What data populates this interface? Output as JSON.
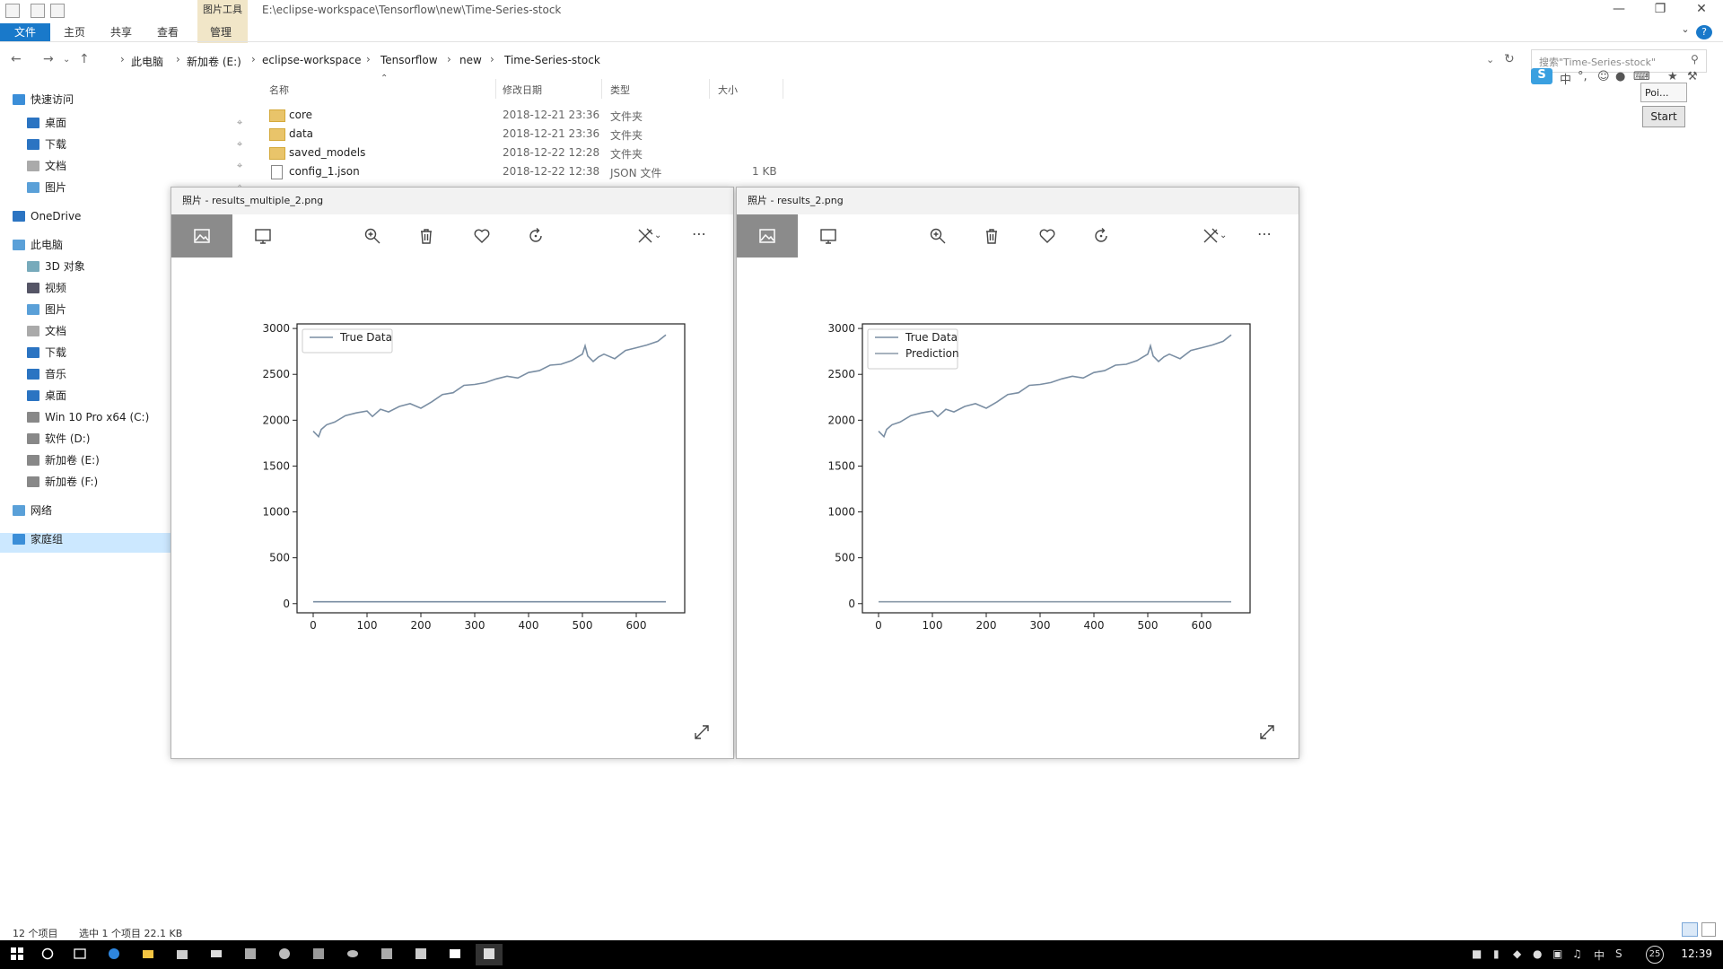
{
  "window": {
    "title_path": "E:\\eclipse-workspace\\Tensorflow\\new\\Time-Series-stock",
    "contextual_tab": "图片工具"
  },
  "ribbon": {
    "tabs": [
      "文件",
      "主页",
      "共享",
      "查看",
      "管理"
    ]
  },
  "address": {
    "crumbs": [
      "此电脑",
      "新加卷 (E:)",
      "eclipse-workspace",
      "Tensorflow",
      "new",
      "Time-Series-stock"
    ],
    "search_placeholder": "搜索\"Time-Series-stock\""
  },
  "ime": {
    "poi_label": "Poi...",
    "start_label": "Start"
  },
  "nav": {
    "items": [
      {
        "label": "快速访问",
        "icon": "star-icon"
      },
      {
        "label": "桌面",
        "icon": "desktop-icon",
        "pinned": true
      },
      {
        "label": "下载",
        "icon": "download-icon",
        "pinned": true
      },
      {
        "label": "文档",
        "icon": "document-icon",
        "pinned": true
      },
      {
        "label": "图片",
        "icon": "picture-icon",
        "pinned": true
      },
      {
        "label": "OneDrive",
        "icon": "cloud-icon"
      },
      {
        "label": "此电脑",
        "icon": "computer-icon"
      },
      {
        "label": "3D 对象",
        "icon": "cube-icon"
      },
      {
        "label": "视频",
        "icon": "video-icon"
      },
      {
        "label": "图片",
        "icon": "picture-icon"
      },
      {
        "label": "文档",
        "icon": "document-icon"
      },
      {
        "label": "下载",
        "icon": "download-icon"
      },
      {
        "label": "音乐",
        "icon": "music-icon"
      },
      {
        "label": "桌面",
        "icon": "desktop-icon"
      },
      {
        "label": "Win 10 Pro x64 (C:)",
        "icon": "drive-icon"
      },
      {
        "label": "软件 (D:)",
        "icon": "drive-icon"
      },
      {
        "label": "新加卷 (E:)",
        "icon": "drive-icon"
      },
      {
        "label": "新加卷 (F:)",
        "icon": "drive-icon"
      },
      {
        "label": "网络",
        "icon": "network-icon"
      },
      {
        "label": "家庭组",
        "icon": "homegroup-icon"
      }
    ]
  },
  "filelist": {
    "headers": [
      "名称",
      "修改日期",
      "类型",
      "大小"
    ],
    "rows": [
      {
        "name": "core",
        "date": "2018-12-21 23:36",
        "type": "文件夹",
        "size": ""
      },
      {
        "name": "data",
        "date": "2018-12-21 23:36",
        "type": "文件夹",
        "size": ""
      },
      {
        "name": "saved_models",
        "date": "2018-12-22 12:28",
        "type": "文件夹",
        "size": ""
      },
      {
        "name": "config_1.json",
        "date": "2018-12-22 12:38",
        "type": "JSON 文件",
        "size": "1 KB"
      }
    ]
  },
  "status": {
    "count": "12 个项目",
    "selection": "选中 1 个项目  22.1 KB"
  },
  "photo_left": {
    "title": "照片 - results_multiple_2.png"
  },
  "photo_right": {
    "title": "照片 - results_2.png"
  },
  "chart_data": [
    {
      "type": "line",
      "xlim": [
        -30,
        690
      ],
      "ylim": [
        -100,
        3050
      ],
      "xticks": [
        0,
        100,
        200,
        300,
        400,
        500,
        600
      ],
      "yticks": [
        0,
        500,
        1000,
        1500,
        2000,
        2500,
        3000
      ],
      "legend_position": "top-left",
      "series": [
        {
          "name": "True Data",
          "color": "#7a8ea3",
          "x": [
            0,
            10,
            15,
            25,
            40,
            60,
            80,
            100,
            110,
            125,
            140,
            160,
            180,
            200,
            220,
            240,
            260,
            280,
            300,
            320,
            340,
            360,
            380,
            400,
            420,
            440,
            460,
            480,
            500,
            505,
            510,
            520,
            530,
            540,
            560,
            580,
            600,
            620,
            640,
            655
          ],
          "y": [
            1880,
            1820,
            1900,
            1950,
            1980,
            2050,
            2080,
            2100,
            2040,
            2120,
            2090,
            2150,
            2180,
            2130,
            2200,
            2280,
            2300,
            2380,
            2390,
            2410,
            2450,
            2480,
            2460,
            2520,
            2540,
            2600,
            2610,
            2650,
            2720,
            2810,
            2700,
            2640,
            2690,
            2720,
            2670,
            2760,
            2790,
            2820,
            2860,
            2930
          ]
        },
        {
          "name": "",
          "color": "#7a8ea3",
          "x": [
            0,
            655
          ],
          "y": [
            20,
            20
          ]
        }
      ]
    },
    {
      "type": "line",
      "xlim": [
        -30,
        690
      ],
      "ylim": [
        -100,
        3050
      ],
      "xticks": [
        0,
        100,
        200,
        300,
        400,
        500,
        600
      ],
      "yticks": [
        0,
        500,
        1000,
        1500,
        2000,
        2500,
        3000
      ],
      "legend_position": "top-left",
      "series": [
        {
          "name": "True Data",
          "color": "#7a8ea3",
          "x": [
            0,
            10,
            15,
            25,
            40,
            60,
            80,
            100,
            110,
            125,
            140,
            160,
            180,
            200,
            220,
            240,
            260,
            280,
            300,
            320,
            340,
            360,
            380,
            400,
            420,
            440,
            460,
            480,
            500,
            505,
            510,
            520,
            530,
            540,
            560,
            580,
            600,
            620,
            640,
            655
          ],
          "y": [
            1880,
            1820,
            1900,
            1950,
            1980,
            2050,
            2080,
            2100,
            2040,
            2120,
            2090,
            2150,
            2180,
            2130,
            2200,
            2280,
            2300,
            2380,
            2390,
            2410,
            2450,
            2480,
            2460,
            2520,
            2540,
            2600,
            2610,
            2650,
            2720,
            2810,
            2700,
            2640,
            2690,
            2720,
            2670,
            2760,
            2790,
            2820,
            2860,
            2930
          ]
        },
        {
          "name": "Prediction",
          "color": "#8a9aa8",
          "x": [
            0,
            655
          ],
          "y": [
            20,
            20
          ]
        }
      ]
    }
  ],
  "taskbar": {
    "clock": "12:39",
    "ime_label": "中",
    "badge": "25"
  }
}
